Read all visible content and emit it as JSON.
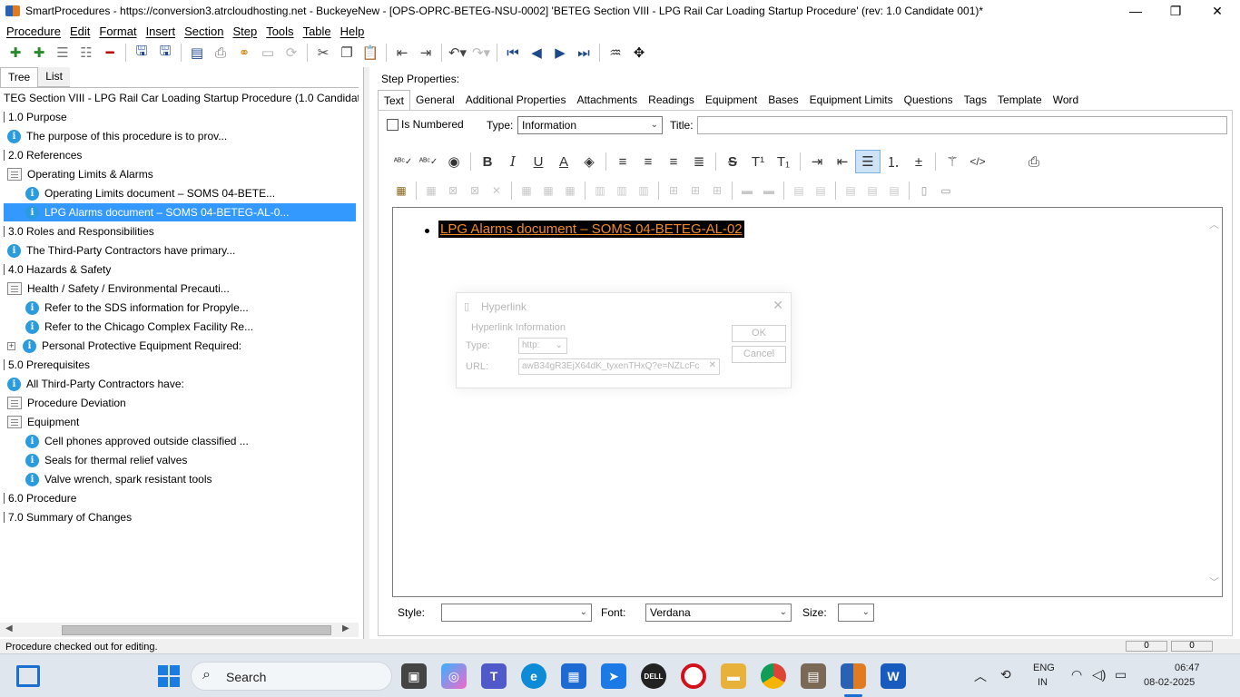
{
  "window": {
    "title": "SmartProcedures - https://conversion3.atrcloudhosting.net - BuckeyeNew - [OPS-OPRC-BETEG-NSU-0002] 'BETEG Section VIII - LPG Rail Car Loading Startup Procedure' (rev: 1.0 Candidate 001)*",
    "minimize": "—",
    "maximize": "❐",
    "close": "✕"
  },
  "menu": [
    "Procedure",
    "Edit",
    "Format",
    "Insert",
    "Section",
    "Step",
    "Tools",
    "Table",
    "Help"
  ],
  "left_tabs": [
    "Tree",
    "List"
  ],
  "tree": {
    "root": "TEG Section VIII - LPG Rail Car Loading Startup Procedure (1.0 Candidate...",
    "items": [
      {
        "text": "1.0 Purpose"
      },
      {
        "text": "The purpose of this procedure is to prov..."
      },
      {
        "text": "2.0 References"
      },
      {
        "text": "Operating Limits & Alarms"
      },
      {
        "text": "Operating Limits document – SOMS 04-BETE..."
      },
      {
        "text": "LPG Alarms document – SOMS 04-BETEG-AL-0..."
      },
      {
        "text": "3.0 Roles and Responsibilities"
      },
      {
        "text": "The Third-Party Contractors have primary..."
      },
      {
        "text": "4.0 Hazards & Safety"
      },
      {
        "text": "Health / Safety / Environmental Precauti..."
      },
      {
        "text": "Refer to the SDS information for Propyle..."
      },
      {
        "text": "Refer to the Chicago Complex Facility Re..."
      },
      {
        "text": "Personal Protective Equipment Required:"
      },
      {
        "text": "5.0 Prerequisites"
      },
      {
        "text": "All Third-Party Contractors have:"
      },
      {
        "text": "Procedure Deviation"
      },
      {
        "text": "Equipment"
      },
      {
        "text": "Cell phones approved outside classified ..."
      },
      {
        "text": "Seals for thermal relief valves"
      },
      {
        "text": "Valve wrench, spark resistant tools"
      },
      {
        "text": "6.0 Procedure"
      },
      {
        "text": "7.0 Summary of Changes"
      }
    ]
  },
  "step_properties": {
    "heading": "Step Properties:",
    "tabs": [
      "Text",
      "General",
      "Additional Properties",
      "Attachments",
      "Readings",
      "Equipment",
      "Bases",
      "Equipment Limits",
      "Questions",
      "Tags",
      "Template",
      "Word"
    ],
    "is_numbered_label": "Is Numbered",
    "type_label": "Type:",
    "type_value": "Information",
    "title_label": "Title:",
    "title_value": ""
  },
  "editor": {
    "content": "LPG Alarms document – SOMS 04-BETEG-AL-02"
  },
  "hyperlink_dialog": {
    "title": "Hyperlink",
    "section": "Hyperlink Information",
    "type_label": "Type:",
    "type_value": "http:",
    "url_label": "URL:",
    "url_value": "awB34gR3EjX64dK_tyxenTHxQ?e=NZLcFc",
    "ok": "OK",
    "cancel": "Cancel"
  },
  "bottom": {
    "style_label": "Style:",
    "style_value": "",
    "font_label": "Font:",
    "font_value": "Verdana",
    "size_label": "Size:",
    "size_value": ""
  },
  "status": {
    "text": "Procedure checked out for editing.",
    "field1": "0",
    "field2": "0"
  },
  "taskbar": {
    "search": "Search",
    "lang1": "ENG",
    "lang2": "IN",
    "time": "06:47",
    "date": "08-02-2025"
  }
}
